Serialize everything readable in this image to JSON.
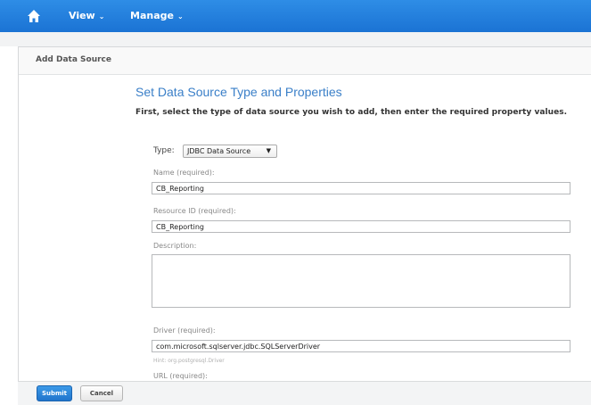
{
  "nav": {
    "home_icon": "home-icon",
    "items": [
      {
        "label": "View"
      },
      {
        "label": "Manage"
      }
    ],
    "chevron": "⌄"
  },
  "panel": {
    "title": "Add Data Source"
  },
  "form": {
    "heading": "Set Data Source Type and Properties",
    "instructions": "First, select the type of data source you wish to add, then enter the required property values.",
    "type": {
      "label": "Type:",
      "selected": "JDBC Data Source"
    },
    "name": {
      "label": "Name (required):",
      "value": "CB_Reporting"
    },
    "resource_id": {
      "label": "Resource ID (required):",
      "value": "CB_Reporting"
    },
    "description": {
      "label": "Description:",
      "value": ""
    },
    "driver": {
      "label": "Driver (required):",
      "value": "com.microsoft.sqlserver.jdbc.SQLServerDriver",
      "hint": "Hint: org.postgresql.Driver"
    },
    "url": {
      "label": "URL (required):"
    }
  },
  "footer": {
    "submit_label": "Submit",
    "cancel_label": "Cancel"
  },
  "colors": {
    "topbar": "#1b73d4",
    "heading": "#3a7fc8",
    "primary_button": "#1f74cc"
  }
}
